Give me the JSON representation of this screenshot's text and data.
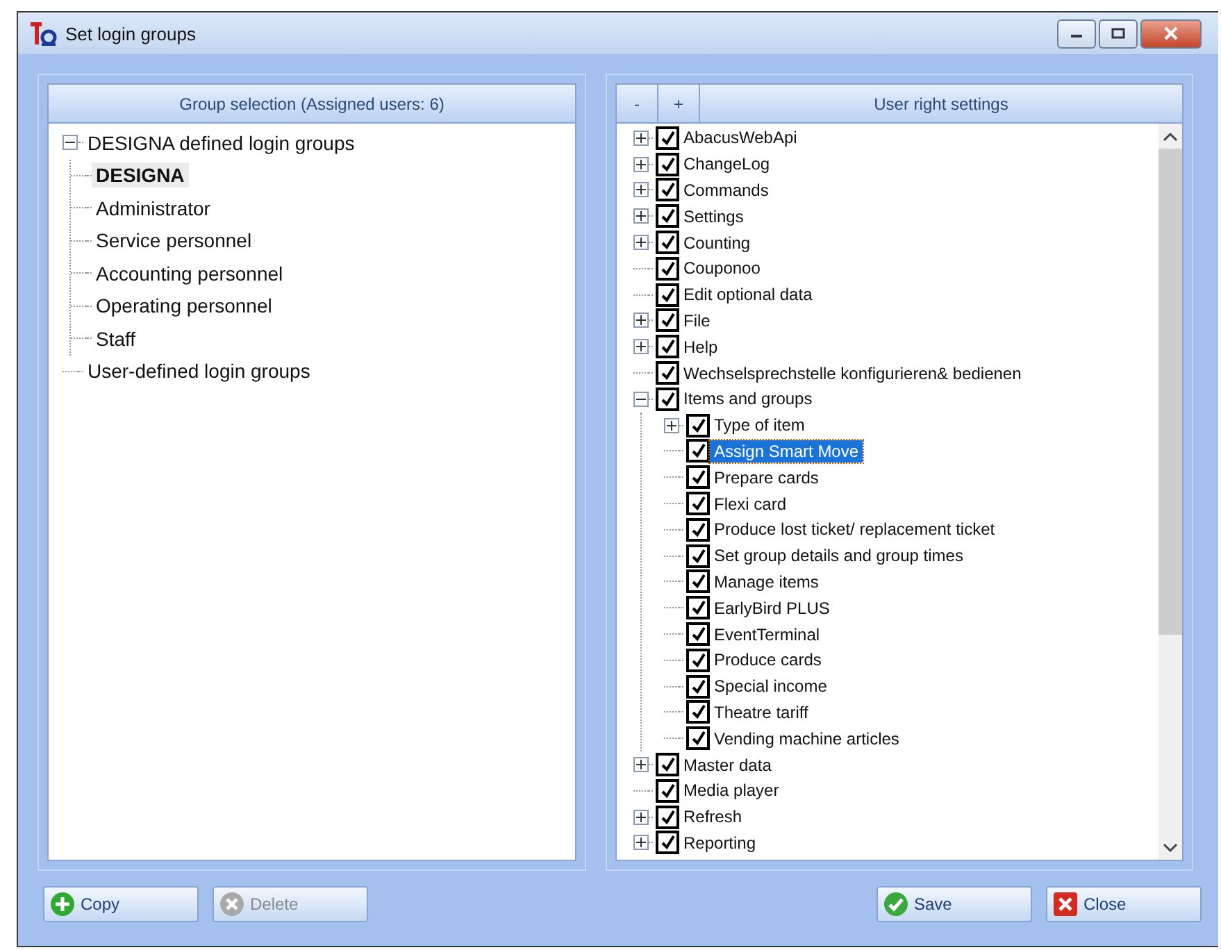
{
  "window": {
    "title": "Set login groups"
  },
  "group_panel": {
    "header": "Group selection (Assigned users: 6)",
    "tree": [
      {
        "label": "DESIGNA defined login groups",
        "expanded": true,
        "selected": false,
        "children": [
          {
            "label": "DESIGNA",
            "selected": true
          },
          {
            "label": "Administrator",
            "selected": false
          },
          {
            "label": "Service personnel",
            "selected": false
          },
          {
            "label": "Accounting personnel",
            "selected": false
          },
          {
            "label": "Operating personnel",
            "selected": false
          },
          {
            "label": "Staff",
            "selected": false
          }
        ]
      },
      {
        "label": "User-defined login groups",
        "selected": false
      }
    ]
  },
  "rights_panel": {
    "collapse_button": "-",
    "expand_button": "+",
    "header": "User right settings",
    "tree": [
      {
        "label": "AbacusWebApi",
        "checked": true,
        "expanded": false,
        "selected": false
      },
      {
        "label": "ChangeLog",
        "checked": true,
        "expanded": false,
        "selected": false
      },
      {
        "label": "Commands",
        "checked": true,
        "expanded": false,
        "selected": false
      },
      {
        "label": "Settings",
        "checked": true,
        "expanded": false,
        "selected": false
      },
      {
        "label": "Counting",
        "checked": true,
        "expanded": false,
        "selected": false
      },
      {
        "label": "Couponoo",
        "checked": true,
        "selected": false
      },
      {
        "label": "Edit optional data",
        "checked": true,
        "selected": false
      },
      {
        "label": "File",
        "checked": true,
        "expanded": false,
        "selected": false
      },
      {
        "label": "Help",
        "checked": true,
        "expanded": false,
        "selected": false
      },
      {
        "label": "Wechselsprechstelle konfigurieren& bedienen",
        "checked": true,
        "selected": false
      },
      {
        "label": "Items and groups",
        "checked": true,
        "expanded": true,
        "selected": false,
        "children": [
          {
            "label": "Type of item",
            "checked": true,
            "expanded": false,
            "selected": false
          },
          {
            "label": "Assign Smart Move",
            "checked": true,
            "selected": true
          },
          {
            "label": "Prepare cards",
            "checked": true,
            "selected": false
          },
          {
            "label": "Flexi card",
            "checked": true,
            "selected": false
          },
          {
            "label": "Produce lost ticket/ replacement ticket",
            "checked": true,
            "selected": false
          },
          {
            "label": "Set group details and group times",
            "checked": true,
            "selected": false
          },
          {
            "label": "Manage items",
            "checked": true,
            "selected": false
          },
          {
            "label": "EarlyBird PLUS",
            "checked": true,
            "selected": false
          },
          {
            "label": "EventTerminal",
            "checked": true,
            "selected": false
          },
          {
            "label": "Produce cards",
            "checked": true,
            "selected": false
          },
          {
            "label": "Special income",
            "checked": true,
            "selected": false
          },
          {
            "label": "Theatre tariff",
            "checked": true,
            "selected": false
          },
          {
            "label": "Vending machine articles",
            "checked": true,
            "selected": false
          }
        ]
      },
      {
        "label": "Master data",
        "checked": true,
        "expanded": false,
        "selected": false
      },
      {
        "label": "Media player",
        "checked": true,
        "selected": false
      },
      {
        "label": "Refresh",
        "checked": true,
        "expanded": false,
        "selected": false
      },
      {
        "label": "Reporting",
        "checked": true,
        "expanded": false,
        "selected": false
      }
    ]
  },
  "buttons": [
    {
      "label": "Copy",
      "kind": "copy",
      "disabled": false
    },
    {
      "label": "Delete",
      "kind": "delete",
      "disabled": true
    },
    {
      "label": "Save",
      "kind": "save",
      "disabled": false
    },
    {
      "label": "Close",
      "kind": "close",
      "disabled": false
    }
  ]
}
